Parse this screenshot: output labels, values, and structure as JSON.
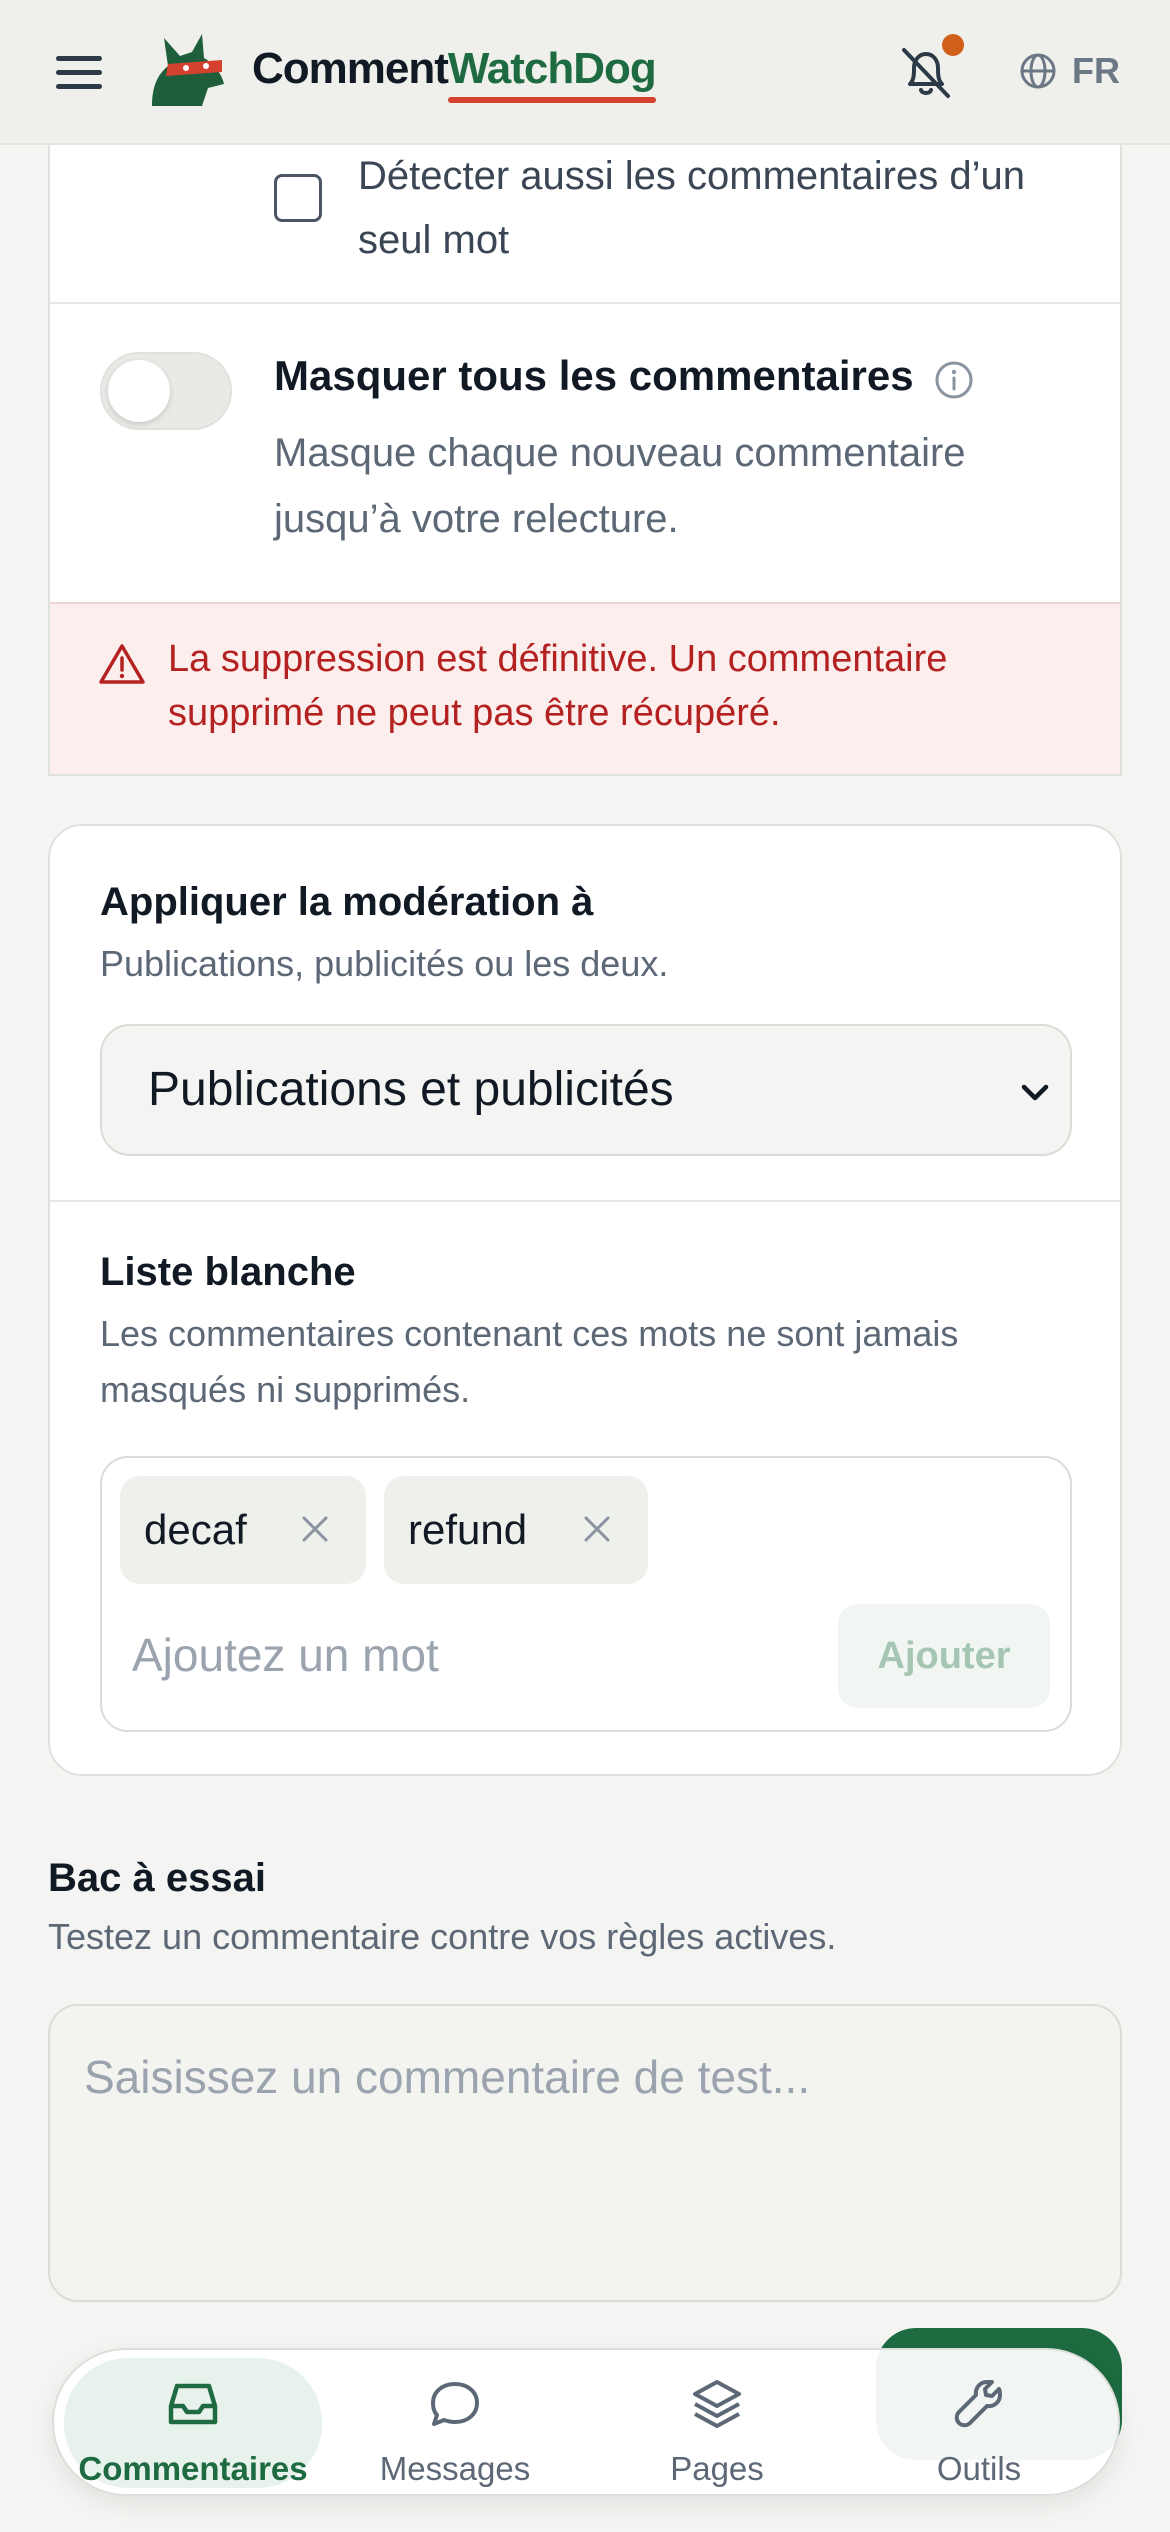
{
  "header": {
    "brand_part1": "Comment",
    "brand_part2": "WatchDog",
    "language_code": "FR",
    "icons": {
      "menu": "menu-icon",
      "logo": "dog-logo-icon",
      "notifications": "bell-off-icon",
      "language": "globe-icon"
    },
    "notification_dot_color": "#d2601a"
  },
  "settings": {
    "single_word_checkbox_label": "Détecter aussi les commentaires d’un seul mot",
    "hide_all_title": "Masquer tous les commentaires",
    "hide_all_description": "Masque chaque nouveau commentaire jusqu’à votre relecture.",
    "warning_text": "La suppression est définitive. Un commentaire supprimé ne peut pas être récupéré."
  },
  "moderation": {
    "apply_title": "Appliquer la modération à",
    "apply_description": "Publications, publicités ou les deux.",
    "apply_selected": "Publications et publicités",
    "whitelist_title": "Liste blanche",
    "whitelist_description": "Les commentaires contenant ces mots ne sont jamais masqués ni supprimés.",
    "whitelist_tags": [
      "decaf",
      "refund"
    ],
    "add_placeholder": "Ajoutez un mot",
    "add_button": "Ajouter"
  },
  "sandbox": {
    "title": "Bac à essai",
    "description": "Testez un commentaire contre vos règles actives.",
    "placeholder": "Saisissez un commentaire de test..."
  },
  "bottom_nav": {
    "items": [
      {
        "label": "Commentaires",
        "icon": "inbox-icon",
        "active": true
      },
      {
        "label": "Messages",
        "icon": "chat-bubble-icon",
        "active": false
      },
      {
        "label": "Pages",
        "icon": "layers-icon",
        "active": false
      },
      {
        "label": "Outils",
        "icon": "wrench-icon",
        "active": false
      }
    ]
  },
  "colors": {
    "brand_green": "#1e6b41",
    "brand_red": "#d4412e",
    "warning_red": "#b42121",
    "warning_bg": "#fdeeee"
  }
}
